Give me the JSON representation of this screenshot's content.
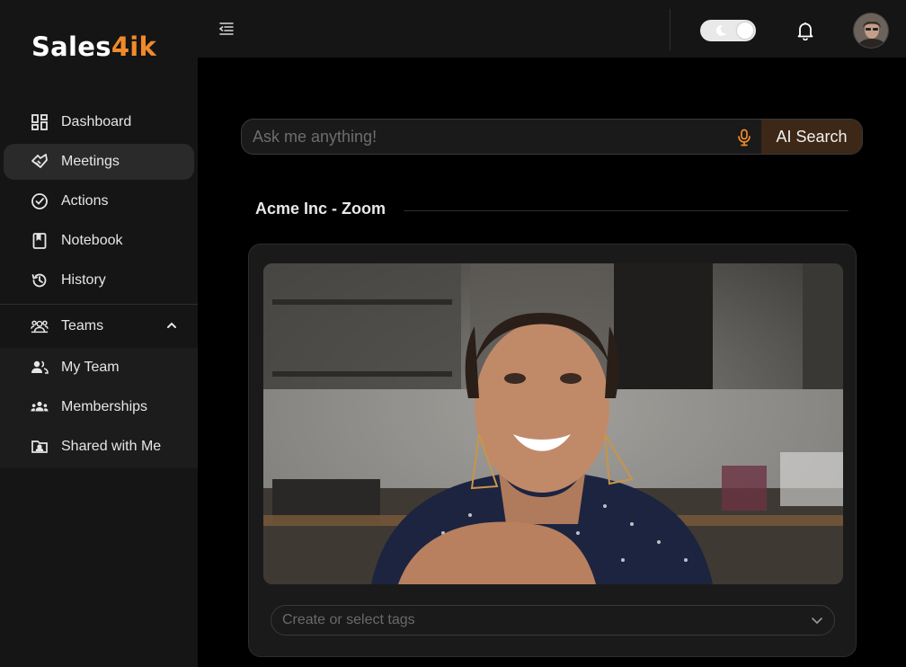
{
  "brand": {
    "logo_main": "Sales",
    "logo_accent": "4ik",
    "accent_color": "#f08a2a"
  },
  "sidebar": {
    "items": [
      {
        "label": "Dashboard",
        "icon": "dashboard-icon"
      },
      {
        "label": "Meetings",
        "icon": "handshake-icon",
        "active": true
      },
      {
        "label": "Actions",
        "icon": "check-circle-icon"
      },
      {
        "label": "Notebook",
        "icon": "notebook-icon"
      },
      {
        "label": "History",
        "icon": "history-icon"
      }
    ],
    "teams": {
      "label": "Teams",
      "icon": "teams-icon",
      "expanded": true,
      "items": [
        {
          "label": "My Team",
          "icon": "my-team-icon"
        },
        {
          "label": "Memberships",
          "icon": "memberships-icon"
        },
        {
          "label": "Shared with Me",
          "icon": "shared-folder-icon"
        }
      ]
    }
  },
  "topbar": {
    "icons": [
      "menu-collapse-icon",
      "moon-icon",
      "bell-icon"
    ],
    "dark_mode": true
  },
  "search": {
    "placeholder": "Ask me anything!",
    "value": "",
    "button_label": "AI Search",
    "button_color": "#3d2716"
  },
  "meeting": {
    "title": "Acme Inc - Zoom",
    "tags_placeholder": "Create or select tags"
  }
}
